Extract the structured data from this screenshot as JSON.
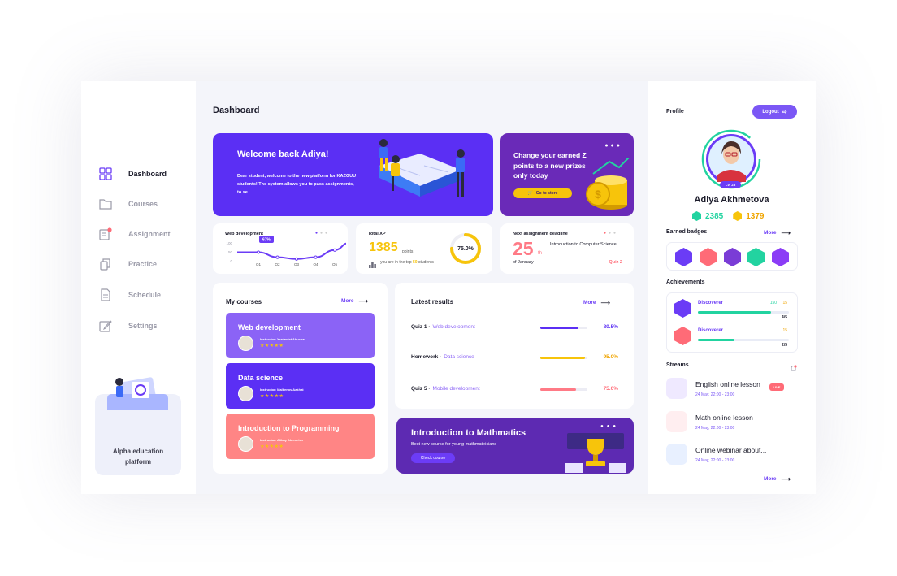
{
  "sidebar": {
    "items": [
      {
        "label": "Dashboard",
        "icon": "dashboard-icon"
      },
      {
        "label": "Courses",
        "icon": "folder-icon"
      },
      {
        "label": "Assignment",
        "icon": "assignment-icon"
      },
      {
        "label": "Practice",
        "icon": "copy-icon"
      },
      {
        "label": "Schedule",
        "icon": "schedule-icon"
      },
      {
        "label": "Settings",
        "icon": "edit-icon"
      }
    ],
    "promo_line1": "Alpha education",
    "promo_line2": "platform"
  },
  "main": {
    "title": "Dashboard",
    "welcome": {
      "heading": "Welcome back Adiya!",
      "text": "Dear student, welcome to the new platform for KAZGUU students! The system allows you to pass assignments, to se"
    },
    "store": {
      "heading": "Change your earned Z points to a new prizes only today",
      "button": "Go to store"
    },
    "web_dev_stat": {
      "title": "Web development",
      "badge": "67%"
    },
    "total_xp": {
      "title": "Total XP",
      "value": "1385",
      "unit": "points",
      "rank_prefix": "you are in the top",
      "rank_value": "50",
      "rank_suffix": "students",
      "percent": "75.0%",
      "percent_value": 0.75
    },
    "deadline": {
      "title": "Next assignment deadline",
      "day": "25",
      "day_suffix": "th",
      "month": "of January",
      "course": "Introduction to Computer Science",
      "quiz": "Quiz 2"
    },
    "courses": {
      "title": "My courses",
      "more": "More",
      "items": [
        {
          "title": "Web development",
          "instructor": "Instructor: Yerdaulet Abuzhar",
          "stars": "★★★★★",
          "color": "#8b63f6"
        },
        {
          "title": "Data science",
          "instructor": "Instructor: Malkenov Aakhat",
          "stars": "★★★★★",
          "color": "#5b2ff4"
        },
        {
          "title": "Introduction to Programming",
          "instructor": "Instructor: Alibay Akhmetov",
          "stars": "★★★★★",
          "color": "#ff8585"
        }
      ]
    },
    "results": {
      "title": "Latest results",
      "more": "More",
      "rows": [
        {
          "name": "Quiz 1",
          "course": "Web development",
          "percent": "80.5%",
          "value": 0.805,
          "color": "#5b2ff4",
          "course_color": "#8b63f6"
        },
        {
          "name": "Homework",
          "course": "Data science",
          "percent": "95.0%",
          "value": 0.95,
          "color": "#f7c40b",
          "course_color": "#8b63f6"
        },
        {
          "name": "Quiz 5",
          "course": "Mobile development",
          "percent": "75.0%",
          "value": 0.75,
          "color": "#ff7a86",
          "course_color": "#8b63f6"
        }
      ]
    },
    "intro": {
      "heading": "Introduction to Mathmatics",
      "text": "Best new course for young mathmateicians",
      "button": "Check course"
    }
  },
  "profile": {
    "title": "Profile",
    "logout": "Logout",
    "name": "Adiya Akhmetova",
    "level": "Lv. 23",
    "xp": "2385",
    "coins": "1379",
    "badges_title": "Earned badges",
    "badges_more": "More",
    "badges": [
      "#6b3cf6",
      "#ff6b77",
      "#7a3cd6",
      "#22d3a0",
      "#8b3cf6"
    ],
    "achievements_title": "Achievements",
    "achievements": [
      {
        "name": "Discoverer",
        "xp": "150",
        "coins": "15",
        "progress": "4/5",
        "value": 0.8
      },
      {
        "name": "Discoverer",
        "coins": "15",
        "progress": "2/5",
        "value": 0.4
      }
    ],
    "streams_title": "Streams",
    "streams": [
      {
        "title": "English online lesson",
        "date": "24 May, 22:00 - 23:00",
        "live": "LIVE"
      },
      {
        "title": "Math online lesson",
        "date": "24 May, 22:00 - 23:00"
      },
      {
        "title": "Online webinar about...",
        "date": "24 May, 22:00 - 23:00"
      }
    ],
    "streams_more": "More"
  },
  "chart_data": {
    "type": "line",
    "title": "Web development",
    "categories": [
      "Q1",
      "Q2",
      "Q3",
      "Q4",
      "Q5"
    ],
    "y_ticks": [
      "100",
      "50",
      "0"
    ],
    "values": [
      48,
      20,
      10,
      20,
      60
    ],
    "highlight_label": "67%"
  }
}
